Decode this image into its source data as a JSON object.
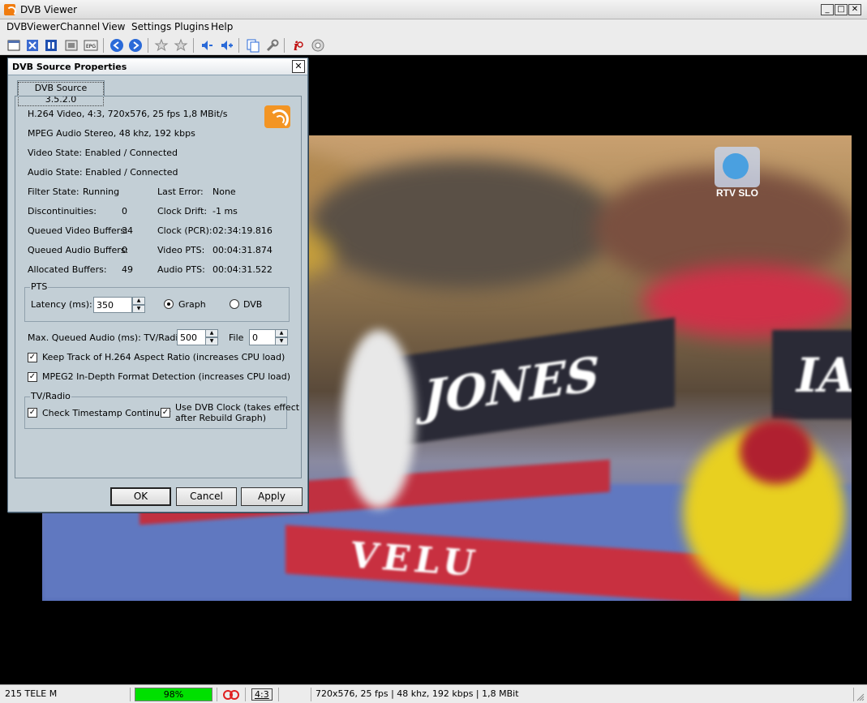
{
  "window": {
    "title": "DVB Viewer"
  },
  "menu": [
    "DVBViewer",
    "Channel",
    "View",
    "Settings",
    "Plugins",
    "Help"
  ],
  "toolbar": {
    "icons": [
      "window-icon",
      "fullscreen-icon",
      "teletext-icon",
      "osd-icon",
      "epg-icon",
      "back-icon",
      "forward-icon",
      "favorite-icon",
      "favorite-add-icon",
      "volume-down-icon",
      "volume-up-icon",
      "copy-icon",
      "tools-icon",
      "info-icon",
      "record-icon"
    ],
    "epg_label": "EPG"
  },
  "video": {
    "channel_logo": "RTV SLO",
    "banner_text_1": "JONES",
    "banner_text_2": "IA",
    "floor_text": "VELU"
  },
  "dialog": {
    "title": "DVB Source Properties",
    "close_glyph": "✕",
    "tab": "DVB Source 3.5.2.0",
    "video_info": "H.264 Video, 4:3, 720x576, 25 fps  1,8 MBit/s",
    "audio_info": "MPEG Audio Stereo, 48 khz, 192 kbps",
    "video_state": "Video State:  Enabled / Connected",
    "audio_state": "Audio State:  Enabled / Connected",
    "stats_left": [
      {
        "label": "Filter State:",
        "value": "Running"
      },
      {
        "label": "Discontinuities:",
        "value": "0"
      },
      {
        "label": "Queued Video Buffers:",
        "value": "34"
      },
      {
        "label": "Queued Audio Buffers:",
        "value": "0"
      },
      {
        "label": "Allocated Buffers:",
        "value": "49"
      }
    ],
    "stats_right": [
      {
        "label": "Last Error:",
        "value": "None"
      },
      {
        "label": "Clock Drift:",
        "value": "-1 ms"
      },
      {
        "label": "Clock (PCR):",
        "value": "02:34:19.816"
      },
      {
        "label": "Video PTS:",
        "value": "00:04:31.874"
      },
      {
        "label": "Audio PTS:",
        "value": "00:04:31.522"
      }
    ],
    "pts_group": {
      "title": "PTS",
      "latency_label": "Latency (ms):",
      "latency_value": "350",
      "radio_graph": "Graph",
      "radio_dvb": "DVB",
      "selected": "Graph"
    },
    "max_queued_label": "Max. Queued Audio (ms): TV/Radio",
    "max_queued_tv": "500",
    "file_label": "File",
    "file_value": "0",
    "check_h264": "Keep Track of H.264 Aspect Ratio (increases CPU load)",
    "check_mpeg2": "MPEG2 In-Depth Format Detection (increases CPU load)",
    "tvradio_group": {
      "title": "TV/Radio",
      "check_timestamp": "Check Timestamp Continuity",
      "check_dvb_clock_1": "Use DVB Clock (takes effect",
      "check_dvb_clock_2": "after Rebuild Graph)"
    },
    "buttons": {
      "ok": "OK",
      "cancel": "Cancel",
      "apply": "Apply"
    }
  },
  "statusbar": {
    "channel": "215 TELE M",
    "signal": "98%",
    "signal_level": 0.98,
    "aspect": "4:3",
    "stream_info": "720x576, 25 fps | 48 khz, 192 kbps | 1,8 MBit",
    "colors": {
      "signal": "#00e000",
      "stereo_icon": "#e02020"
    }
  }
}
